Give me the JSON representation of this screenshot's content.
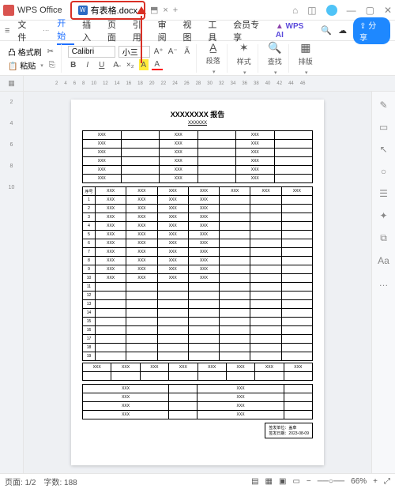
{
  "titlebar": {
    "app_name": "WPS Office",
    "tab_filename": "有表格.docx",
    "tab_close": "×",
    "tab_add": "+",
    "icons": {
      "refresh": "⟳",
      "cube": "⬚",
      "min": "—",
      "max": "▢",
      "close": "✕"
    }
  },
  "menubar": {
    "file": "文件",
    "items": [
      "开始",
      "插入",
      "页面",
      "引用",
      "审阅",
      "视图",
      "工具",
      "会员专享"
    ],
    "active_index": 0,
    "wps_ai": "WPS AI",
    "search_icon": "Q",
    "cloud_icon": "☁",
    "share": "分享"
  },
  "ribbon": {
    "format_brush": "格式刷",
    "paste": "粘贴",
    "font_name": "Calibri",
    "font_size": "小三",
    "paragraph": "段落",
    "styles": "样式",
    "find": "查找",
    "arrange": "排版"
  },
  "ruler": {
    "nav_icon": "▭",
    "ticks": [
      "2",
      "4",
      "6",
      "8",
      "10",
      "12",
      "14",
      "16",
      "18",
      "20",
      "22",
      "24",
      "26",
      "28",
      "30",
      "32",
      "34",
      "36",
      "38",
      "40",
      "42",
      "44",
      "46"
    ]
  },
  "doc": {
    "title": "XXXXXXXX 报告",
    "subtitle": "XXXXXX",
    "info_rows": [
      [
        "XXX",
        "",
        "XXX",
        "",
        "XXX",
        ""
      ],
      [
        "XXX",
        "",
        "XXX",
        "",
        "XXX",
        ""
      ],
      [
        "XXX",
        "",
        "XXX",
        "",
        "XXX",
        ""
      ],
      [
        "XXX",
        "",
        "XXX",
        "",
        "XXX",
        ""
      ],
      [
        "XXX",
        "",
        "XXX",
        "",
        "XXX",
        ""
      ],
      [
        "XXX",
        "",
        "XXX",
        "",
        "XXX",
        ""
      ]
    ],
    "main_header": [
      "序号",
      "XXX",
      "XXX",
      "XXX",
      "XXX",
      "XXX",
      "XXX",
      "XXX"
    ],
    "row_count": 19,
    "filled_rows": 10,
    "bottom_header": [
      "XXX",
      "XXX",
      "XXX",
      "XXX",
      "XXX",
      "XXX",
      "XXX",
      "XXX"
    ],
    "sig_unit_label": "签发单位：",
    "sig_unit_value": "盖章",
    "sig_date_label": "签发日期：",
    "sig_date_value": "2023-08-09",
    "small_rows": [
      [
        "XXX",
        "",
        "XXX",
        ""
      ],
      [
        "XXX",
        "",
        "XXX",
        ""
      ],
      [
        "XXX",
        "",
        "XXX",
        ""
      ],
      [
        "XXX",
        "",
        "XXX",
        ""
      ]
    ]
  },
  "right_tools": [
    "✎",
    "▭",
    "↖",
    "○",
    "☰",
    "✦",
    "⧉",
    "Aa",
    "…"
  ],
  "statusbar": {
    "page_label": "页面:",
    "page_value": "1/2",
    "word_label": "字数:",
    "word_value": "188",
    "zoom": "66%",
    "zoom_minus": "−",
    "zoom_plus": "+",
    "fit_icon": "⤢"
  }
}
